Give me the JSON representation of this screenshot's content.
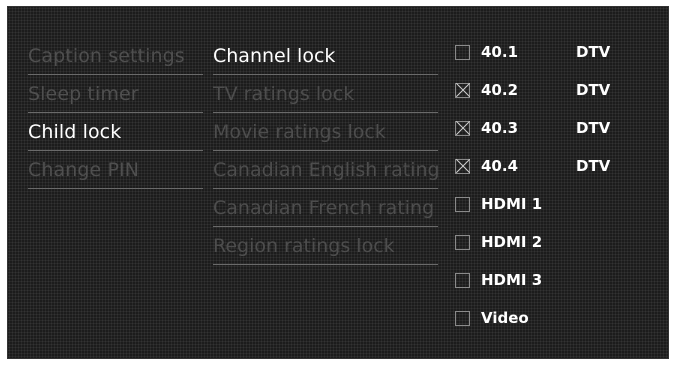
{
  "menu_level1": [
    {
      "label": "Caption settings",
      "state": "muted"
    },
    {
      "label": "Sleep timer",
      "state": "muted"
    },
    {
      "label": "Child lock",
      "state": "active"
    },
    {
      "label": "Change PIN",
      "state": "muted"
    }
  ],
  "menu_level2": [
    {
      "label": "Channel lock",
      "state": "active"
    },
    {
      "label": "TV ratings lock",
      "state": "muted"
    },
    {
      "label": "Movie ratings lock",
      "state": "muted"
    },
    {
      "label": "Canadian English rating",
      "state": "muted"
    },
    {
      "label": "Canadian French rating",
      "state": "muted"
    },
    {
      "label": "Region ratings lock",
      "state": "muted"
    }
  ],
  "channels": [
    {
      "label": "40.1",
      "type": "DTV",
      "checked": false
    },
    {
      "label": "40.2",
      "type": "DTV",
      "checked": true
    },
    {
      "label": "40.3",
      "type": "DTV",
      "checked": true
    },
    {
      "label": "40.4",
      "type": "DTV",
      "checked": true
    },
    {
      "label": "HDMI 1",
      "type": "",
      "checked": false
    },
    {
      "label": "HDMI 2",
      "type": "",
      "checked": false
    },
    {
      "label": "HDMI 3",
      "type": "",
      "checked": false
    },
    {
      "label": "Video",
      "type": "",
      "checked": false
    }
  ]
}
